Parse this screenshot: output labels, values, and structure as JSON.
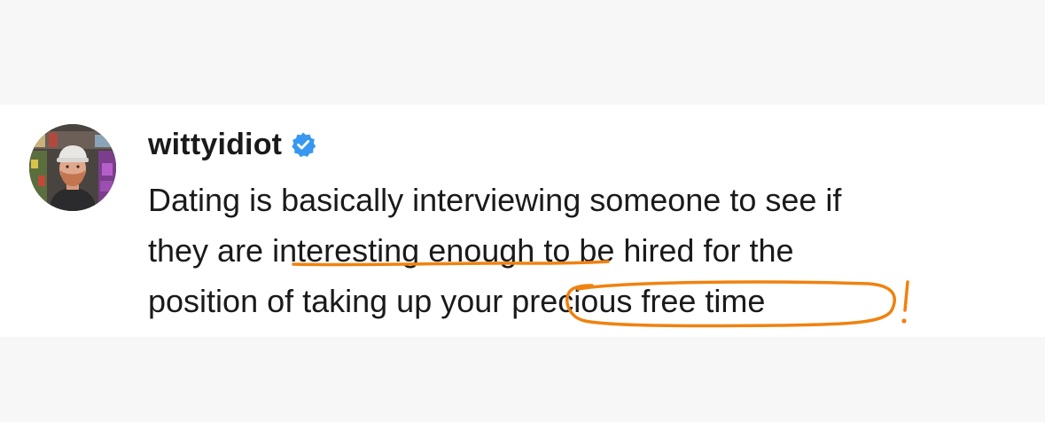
{
  "post": {
    "username": "wittyidiot",
    "verified": true,
    "caption_lines": [
      {
        "text": "Dating is basically interviewing someone to see if"
      },
      {
        "before": "they are ",
        "underlined": "interesting enough",
        "after": " to be hired for the"
      },
      {
        "before": "position of taking up your ",
        "circled": "precious free time"
      }
    ]
  },
  "annotations": {
    "color": "#f0820f",
    "exclamation": "!"
  },
  "colors": {
    "verified_badge": "#3897f0",
    "text": "#1a1a1a",
    "background_card": "#ffffff",
    "background_bands": "#f7f7f7"
  },
  "icons": {
    "verified": "verified-badge-icon",
    "avatar": "profile-photo"
  }
}
